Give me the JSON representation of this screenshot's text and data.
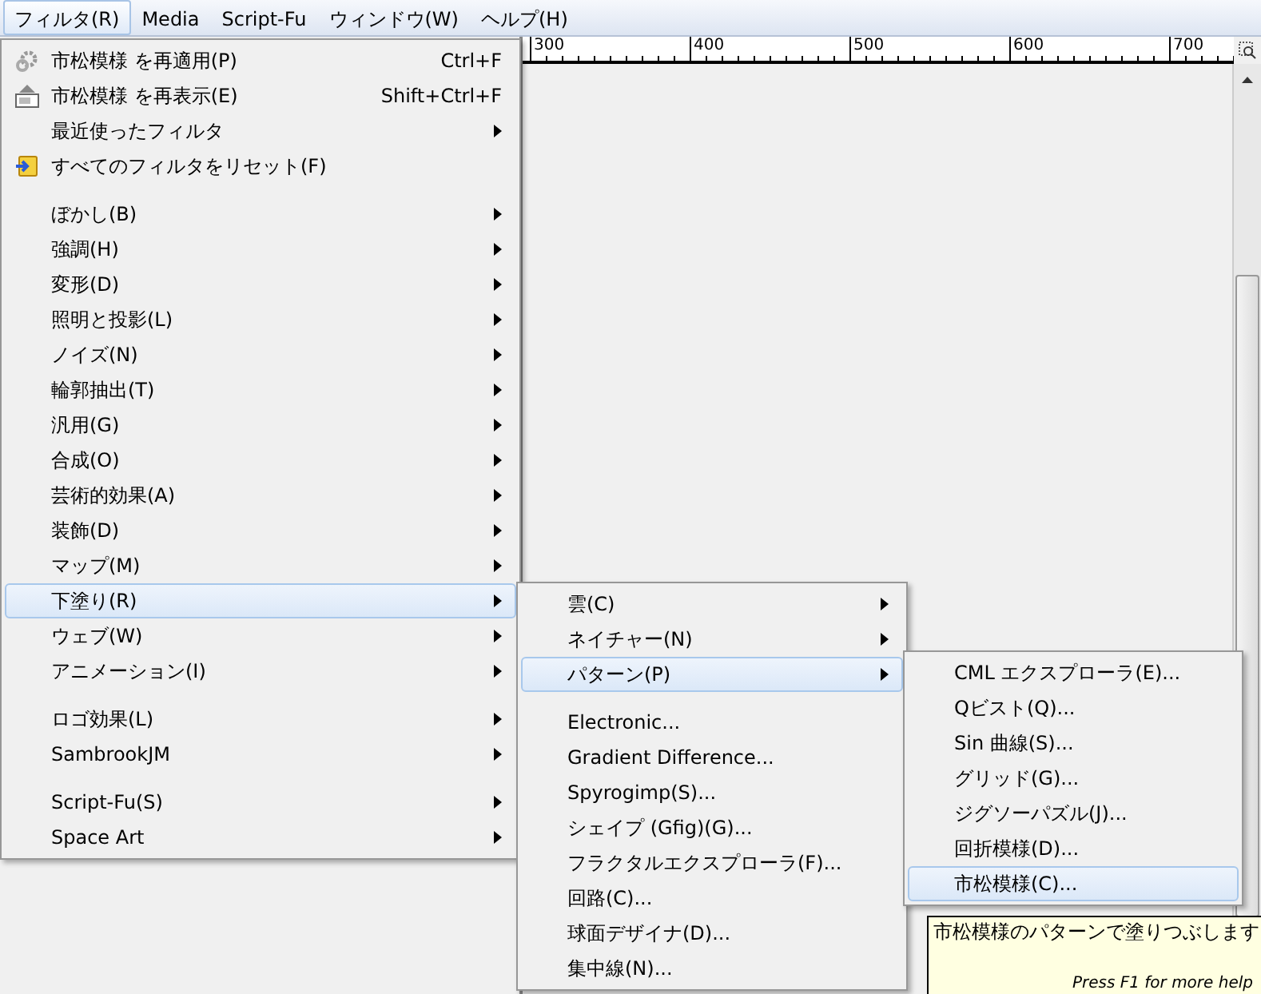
{
  "menubar": [
    {
      "label": "フィルタ(R)",
      "selected": true
    },
    {
      "label": "Media",
      "selected": false
    },
    {
      "label": "Script-Fu",
      "selected": false
    },
    {
      "label": "ウィンドウ(W)",
      "selected": false
    },
    {
      "label": "ヘルプ(H)",
      "selected": false
    }
  ],
  "ruler": {
    "labels": [
      "300",
      "400",
      "500",
      "600",
      "700"
    ]
  },
  "filters_menu": [
    {
      "kind": "reapply",
      "label": "市松模様 を再適用(P)",
      "disabled": false,
      "shortcut": "Ctrl+F",
      "submenu": false,
      "selected": false
    },
    {
      "kind": "reshow",
      "label": "市松模様 を再表示(E)",
      "disabled": false,
      "shortcut": "Shift+Ctrl+F",
      "submenu": false,
      "selected": false
    },
    {
      "kind": "item",
      "label": "最近使ったフィルタ",
      "submenu": true,
      "selected": false
    },
    {
      "kind": "reset",
      "label": "すべてのフィルタをリセット(F)",
      "submenu": false,
      "selected": false
    },
    {
      "kind": "separator"
    },
    {
      "kind": "item",
      "label": "ぼかし(B)",
      "submenu": true,
      "selected": false
    },
    {
      "kind": "item",
      "label": "強調(H)",
      "submenu": true,
      "selected": false
    },
    {
      "kind": "item",
      "label": "変形(D)",
      "submenu": true,
      "selected": false
    },
    {
      "kind": "item",
      "label": "照明と投影(L)",
      "submenu": true,
      "selected": false
    },
    {
      "kind": "item",
      "label": "ノイズ(N)",
      "submenu": true,
      "selected": false
    },
    {
      "kind": "item",
      "label": "輪郭抽出(T)",
      "submenu": true,
      "selected": false
    },
    {
      "kind": "item",
      "label": "汎用(G)",
      "submenu": true,
      "selected": false
    },
    {
      "kind": "item",
      "label": "合成(O)",
      "submenu": true,
      "selected": false
    },
    {
      "kind": "item",
      "label": "芸術的効果(A)",
      "submenu": true,
      "selected": false
    },
    {
      "kind": "item",
      "label": "装飾(D)",
      "submenu": true,
      "selected": false
    },
    {
      "kind": "item",
      "label": "マップ(M)",
      "submenu": true,
      "selected": false
    },
    {
      "kind": "item",
      "label": "下塗り(R)",
      "submenu": true,
      "selected": true
    },
    {
      "kind": "item",
      "label": "ウェブ(W)",
      "submenu": true,
      "selected": false
    },
    {
      "kind": "item",
      "label": "アニメーション(I)",
      "submenu": true,
      "selected": false
    },
    {
      "kind": "separator"
    },
    {
      "kind": "item",
      "label": "ロゴ効果(L)",
      "submenu": true,
      "selected": false
    },
    {
      "kind": "item",
      "label": "SambrookJM",
      "submenu": true,
      "selected": false
    },
    {
      "kind": "separator"
    },
    {
      "kind": "item",
      "label": "Script-Fu(S)",
      "submenu": true,
      "selected": false
    },
    {
      "kind": "item",
      "label": "Space Art",
      "submenu": true,
      "selected": false
    }
  ],
  "render_menu": [
    {
      "kind": "item",
      "label": "雲(C)",
      "submenu": true,
      "selected": false
    },
    {
      "kind": "item",
      "label": "ネイチャー(N)",
      "submenu": true,
      "selected": false
    },
    {
      "kind": "item",
      "label": "パターン(P)",
      "submenu": true,
      "selected": true
    },
    {
      "kind": "separator"
    },
    {
      "kind": "item",
      "label": "Electronic...",
      "submenu": false,
      "selected": false
    },
    {
      "kind": "item",
      "label": "Gradient Difference...",
      "submenu": false,
      "selected": false
    },
    {
      "kind": "item",
      "label": "Spyrogimp(S)...",
      "submenu": false,
      "selected": false
    },
    {
      "kind": "item",
      "label": "シェイプ (Gfig)(G)...",
      "submenu": false,
      "selected": false
    },
    {
      "kind": "item",
      "label": "フラクタルエクスプローラ(F)...",
      "submenu": false,
      "selected": false
    },
    {
      "kind": "item",
      "label": "回路(C)...",
      "submenu": false,
      "selected": false
    },
    {
      "kind": "item",
      "label": "球面デザイナ(D)...",
      "submenu": false,
      "selected": false
    },
    {
      "kind": "item",
      "label": "集中線(N)...",
      "submenu": false,
      "selected": false
    }
  ],
  "pattern_menu": [
    {
      "kind": "item",
      "label": "CML エクスプローラ(E)...",
      "submenu": false,
      "selected": false
    },
    {
      "kind": "item",
      "label": "Qビスト(Q)...",
      "submenu": false,
      "selected": false
    },
    {
      "kind": "item",
      "label": "Sin 曲線(S)...",
      "submenu": false,
      "selected": false
    },
    {
      "kind": "item",
      "label": "グリッド(G)...",
      "submenu": false,
      "selected": false
    },
    {
      "kind": "item",
      "label": "ジグソーパズル(J)...",
      "submenu": false,
      "selected": false
    },
    {
      "kind": "item",
      "label": "回折模様(D)...",
      "submenu": false,
      "selected": false
    },
    {
      "kind": "item",
      "label": "市松模様(C)...",
      "submenu": false,
      "selected": true
    }
  ],
  "tooltip": {
    "text": "市松模様のパターンで塗りつぶします",
    "hint": "Press F1 for more help"
  }
}
